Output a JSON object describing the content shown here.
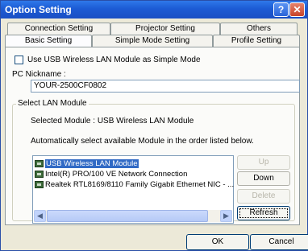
{
  "window": {
    "title": "Option Setting"
  },
  "tabs_back": [
    "Connection Setting",
    "Projector Setting",
    "Others"
  ],
  "tabs_front": [
    "Basic Setting",
    "Simple Mode Setting",
    "Profile Setting"
  ],
  "basic": {
    "usb_checkbox_label": "Use USB Wireless LAN Module as Simple Mode",
    "usb_checked": false,
    "pc_nickname_label": "PC Nickname :",
    "pc_nickname_value": "YOUR-2500CF0802"
  },
  "lan": {
    "group_title": "Select LAN Module",
    "selected_text": "Selected Module : USB Wireless LAN Module",
    "auto_text": "Automatically select available Module in the order listed below.",
    "modules": [
      "USB Wireless LAN Module",
      "Intel(R) PRO/100 VE Network Connection",
      "Realtek RTL8169/8110 Family Gigabit Ethernet NIC - ..."
    ],
    "selected_index": 0,
    "buttons": {
      "up": "Up",
      "down": "Down",
      "delete": "Delete",
      "refresh": "Refresh"
    }
  },
  "footer": {
    "ok": "OK",
    "cancel": "Cancel"
  },
  "colors": {
    "titlebar": "#1c5bd4",
    "selection": "#316ac5"
  }
}
